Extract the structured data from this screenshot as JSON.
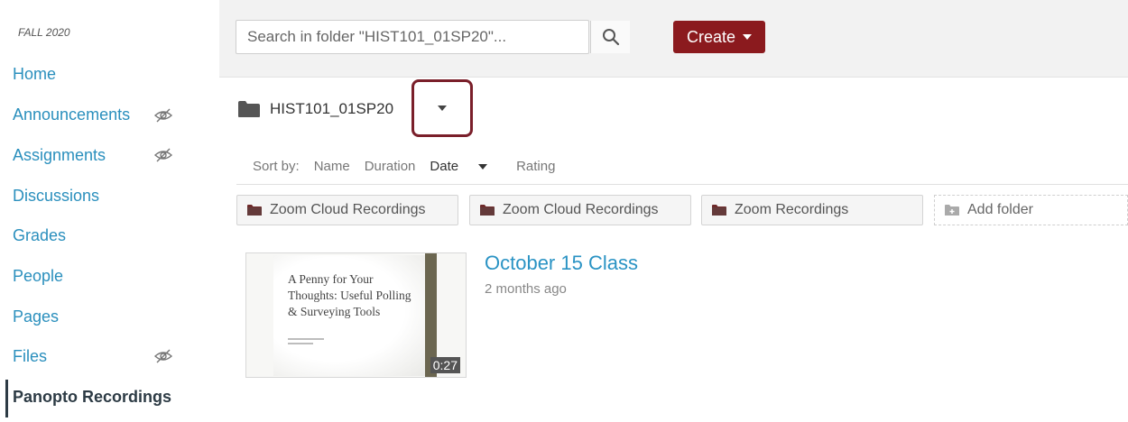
{
  "sidebar": {
    "term": "FALL 2020",
    "items": [
      {
        "label": "Home",
        "hidden": false
      },
      {
        "label": "Announcements",
        "hidden": true
      },
      {
        "label": "Assignments",
        "hidden": true
      },
      {
        "label": "Discussions",
        "hidden": false
      },
      {
        "label": "Grades",
        "hidden": false
      },
      {
        "label": "People",
        "hidden": false
      },
      {
        "label": "Pages",
        "hidden": false
      },
      {
        "label": "Files",
        "hidden": true
      },
      {
        "label": "Panopto Recordings",
        "hidden": false,
        "active": true
      }
    ]
  },
  "toolbar": {
    "search_placeholder": "Search in folder \"HIST101_01SP20\"...",
    "create_label": "Create"
  },
  "folder": {
    "title": "HIST101_01SP20"
  },
  "sort": {
    "label": "Sort by:",
    "options": [
      "Name",
      "Duration",
      "Date",
      "Rating"
    ],
    "active": "Date"
  },
  "subfolders": [
    {
      "label": "Zoom Cloud Recordings"
    },
    {
      "label": "Zoom Cloud Recordings"
    },
    {
      "label": "Zoom Recordings"
    }
  ],
  "add_folder_label": "Add folder",
  "session": {
    "title": "October 15 Class",
    "date": "2 months ago",
    "duration": "0:27",
    "thumbnail_text": "A Penny for Your Thoughts: Useful Polling & Surveying Tools"
  },
  "colors": {
    "link": "#2a8fbd",
    "create_button": "#8b1a1e",
    "highlight_border": "#7a1f2a",
    "folder_icon": "#6e2a2a"
  }
}
